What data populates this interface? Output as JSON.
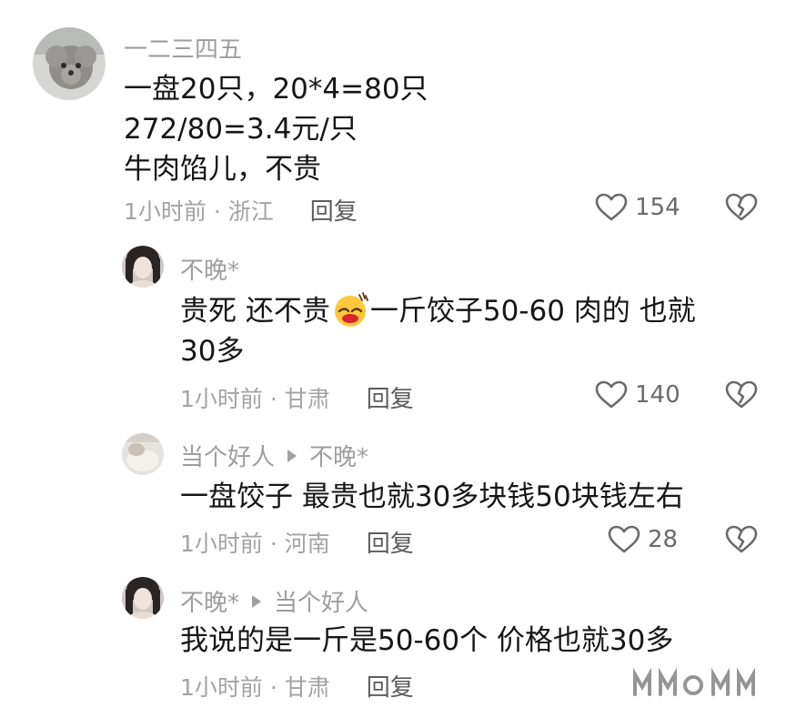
{
  "comments": [
    {
      "username": "一二三四五",
      "lines": [
        "一盘20只，20*4=80只",
        "272/80=3.4元/只",
        "牛肉馅儿，不贵"
      ],
      "time_location": "1小时前 · 浙江",
      "reply_label": "回复",
      "likes": "154"
    },
    {
      "username": "不晚*",
      "line1_before_emoji": "贵死 还不贵",
      "line1_after_emoji": "一斤饺子50-60   肉的  也就",
      "line2": "30多",
      "time_location": "1小时前 · 甘肃",
      "reply_label": "回复",
      "likes": "140"
    },
    {
      "username": "当个好人",
      "reply_to": "不晚*",
      "text": "一盘饺子 最贵也就30多块钱50块钱左右",
      "time_location": "1小时前 · 河南",
      "reply_label": "回复",
      "likes": "28"
    },
    {
      "username": "不晚*",
      "reply_to": "当个好人",
      "text": "我说的是一斤是50-60个  价格也就30多",
      "time_location": "1小时前 · 甘肃",
      "reply_label": "回复"
    }
  ],
  "icons": {
    "like": "heart-outline-icon",
    "dislike": "broken-heart-icon",
    "emoji": "sweating-crying-face-emoji"
  },
  "colors": {
    "username": "#9e9e9e",
    "text": "#161616",
    "meta": "#a3a3a3"
  }
}
